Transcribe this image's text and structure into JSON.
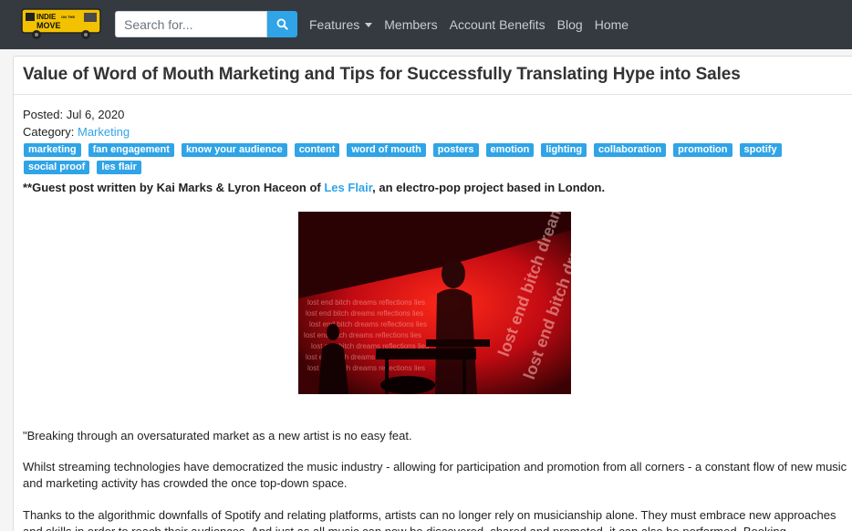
{
  "navbar": {
    "logo_text": "INDIE ON THE MOVE",
    "search_placeholder": "Search for...",
    "links": [
      {
        "label": "Features"
      },
      {
        "label": "Members"
      },
      {
        "label": "Account Benefits"
      },
      {
        "label": "Blog"
      },
      {
        "label": "Home"
      }
    ]
  },
  "article": {
    "title": "Value of Word of Mouth Marketing and Tips for Successfully Translating Hype into Sales",
    "posted_label": "Posted:",
    "posted_date": "Jul 6, 2020",
    "category_label": "Category:",
    "category": "Marketing",
    "tags": [
      "marketing",
      "fan engagement",
      "know your audience",
      "content",
      "word of mouth",
      "posters",
      "emotion",
      "lighting",
      "collaboration",
      "promotion",
      "spotify",
      "social proof",
      "les flair"
    ],
    "intro_prefix": "**Guest post written by Kai Marks & Lyron Haceon of ",
    "intro_link": "Les Flair",
    "intro_suffix": ", an electro-pop project based in London.",
    "photo_projection_text": "lost end bitch dreams reflections lies",
    "paragraphs": [
      "\"Breaking through an oversaturated market as a new artist is no easy feat.",
      "Whilst streaming technologies have democratized the music industry - allowing for participation and promotion from all corners - a constant flow of new music and marketing activity has crowded the once top-down space.",
      "Thanks to the algorithmic downfalls of Spotify and relating platforms, artists can no longer rely on musicianship alone. They must embrace new approaches and skills in order to reach their audiences. And just as all music can now be discovered, shared and promoted, it can also be performed. Booking"
    ]
  },
  "colors": {
    "navbar_bg": "#343a40",
    "accent": "#2fa4e7",
    "photo_red": "#d4101a"
  }
}
